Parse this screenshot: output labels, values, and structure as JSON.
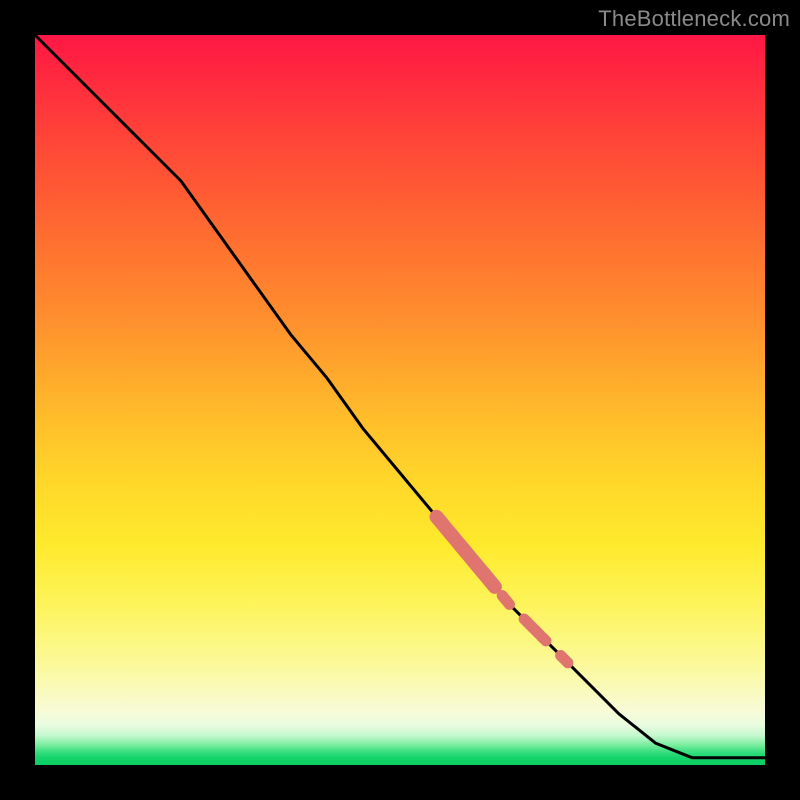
{
  "watermark": "TheBottleneck.com",
  "colors": {
    "curve": "#000000",
    "highlight": "#e0746f",
    "background_frame": "#000000"
  },
  "chart_data": {
    "type": "line",
    "title": "",
    "xlabel": "",
    "ylabel": "",
    "xlim": [
      0,
      100
    ],
    "ylim": [
      0,
      100
    ],
    "x": [
      0,
      5,
      10,
      15,
      20,
      25,
      30,
      35,
      40,
      45,
      50,
      55,
      60,
      65,
      70,
      75,
      80,
      85,
      90,
      95,
      100
    ],
    "values": [
      100,
      95,
      90,
      85,
      80,
      73,
      66,
      59,
      53,
      46,
      40,
      34,
      28,
      22,
      17,
      12,
      7,
      3,
      1,
      1,
      1
    ],
    "highlight_segments": [
      {
        "x0": 55,
        "x1": 63
      },
      {
        "x0": 64,
        "x1": 65
      },
      {
        "x0": 67,
        "x1": 70
      },
      {
        "x0": 72,
        "x1": 73
      }
    ]
  }
}
